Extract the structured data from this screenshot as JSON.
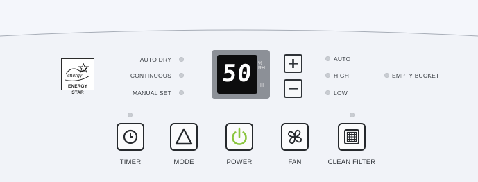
{
  "brand": {
    "energy_star_label": "ENERGY STAR"
  },
  "display": {
    "value": "50",
    "unit_top": "% RH",
    "unit_bottom": "H"
  },
  "mode_indicators": [
    {
      "label": "AUTO DRY"
    },
    {
      "label": "CONTINUOUS"
    },
    {
      "label": "MANUAL SET"
    }
  ],
  "fan_indicators": [
    {
      "label": "AUTO"
    },
    {
      "label": "HIGH"
    },
    {
      "label": "LOW"
    }
  ],
  "status": {
    "empty_bucket": "EMPTY BUCKET"
  },
  "buttons": {
    "increase": {
      "icon": "plus-icon"
    },
    "decrease": {
      "icon": "minus-icon"
    },
    "timer": {
      "label": "TIMER",
      "icon": "clock-icon"
    },
    "mode": {
      "label": "MODE",
      "icon": "triangle-icon"
    },
    "power": {
      "label": "POWER",
      "icon": "power-icon",
      "accent": "#8bc53f"
    },
    "fan": {
      "label": "FAN",
      "icon": "fan-icon"
    },
    "clean_filter": {
      "label": "CLEAN FILTER",
      "icon": "filter-icon"
    }
  },
  "colors": {
    "indicator_off": "#c9ccd2",
    "panel": "#f4f6fb",
    "display_bezel": "#8c9097"
  }
}
